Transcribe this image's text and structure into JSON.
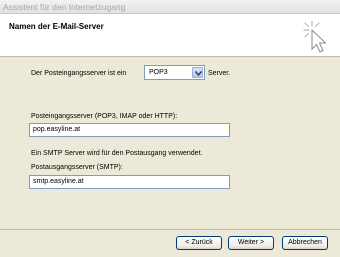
{
  "window": {
    "title": "Assistent für den Internetzugang"
  },
  "header": {
    "heading": "Namen der E-Mail-Server",
    "icon": "wizard-wand-icon"
  },
  "form": {
    "incoming_type_label": "Der Posteingangsserver ist ein",
    "incoming_type_value": "POP3",
    "incoming_type_suffix": "Server.",
    "incoming_server_label": "Posteingangsserver (POP3, IMAP oder HTTP):",
    "incoming_server_value": "pop.easyline.at",
    "smtp_note": "Ein SMTP Server wird für den Postausgang verwendet.",
    "outgoing_server_label": "Postausgangsserver (SMTP):",
    "outgoing_server_value": "smtp.easyline.at"
  },
  "buttons": {
    "back": "< Zurück",
    "next": "Weiter >",
    "cancel": "Abbrechen"
  }
}
